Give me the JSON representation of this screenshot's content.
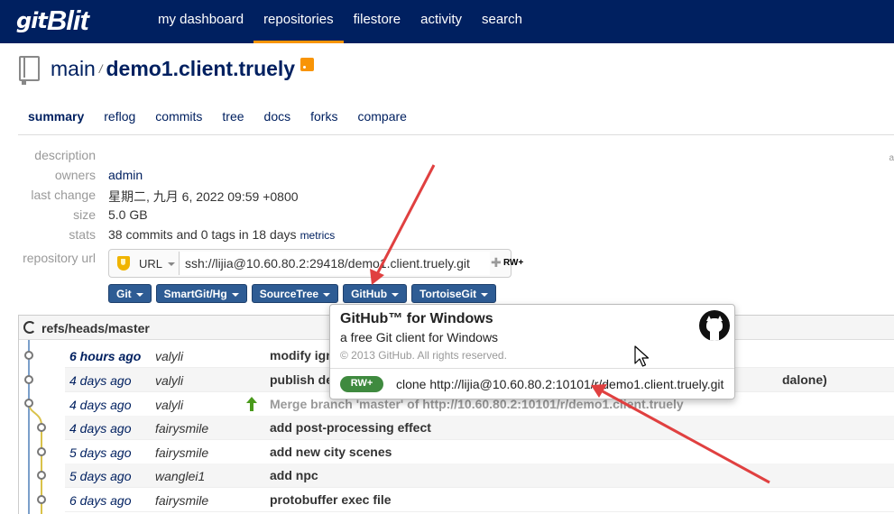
{
  "navbar": {
    "logo_mark": "git",
    "logo_text": "Blit",
    "links": [
      {
        "label": "my dashboard",
        "active": false
      },
      {
        "label": "repositories",
        "active": true
      },
      {
        "label": "filestore",
        "active": false
      },
      {
        "label": "activity",
        "active": false
      },
      {
        "label": "search",
        "active": false
      }
    ],
    "accent_color": "#f89406",
    "bg_color": "#002060"
  },
  "repo": {
    "owner": "main",
    "separator": "/",
    "name": "demo1.client.truely"
  },
  "subnav": {
    "items": [
      "summary",
      "reflog",
      "commits",
      "tree",
      "docs",
      "forks",
      "compare"
    ],
    "active": "summary"
  },
  "summary": {
    "description_label": "description",
    "description_value": "",
    "owners_label": "owners",
    "owners_value": "admin",
    "last_change_label": "last change",
    "last_change_value": "星期二, 九月 6, 2022 09:59 +0800",
    "size_label": "size",
    "size_value": "5.0 GB",
    "stats_label": "stats",
    "stats_value": "38 commits and 0 tags in 18 days",
    "stats_link": "metrics",
    "repo_url_label": "repository url",
    "url_protocol": "URL",
    "url_value": "ssh://lijia@10.60.80.2:29418/demo1.client.truely.git",
    "url_permission": "RW+"
  },
  "clone_buttons": [
    "Git",
    "SmartGit/Hg",
    "SourceTree",
    "GitHub",
    "TortoiseGit"
  ],
  "branch": {
    "title": "refs/heads/master",
    "commits": [
      {
        "date": "6 hours ago",
        "date_bold": true,
        "author": "valyli",
        "message": "modify ign",
        "merge": false
      },
      {
        "date": "4 days ago",
        "date_bold": false,
        "author": "valyli",
        "message": "publish de",
        "message_tail": "dalone)",
        "merge": false
      },
      {
        "date": "4 days ago",
        "date_bold": false,
        "author": "valyli",
        "message": "Merge branch 'master' of http://10.60.80.2:10101/r/demo1.client.truely",
        "merge": true
      },
      {
        "date": "4 days ago",
        "date_bold": false,
        "author": "fairysmile",
        "message": "add post-processing effect",
        "merge": false
      },
      {
        "date": "5 days ago",
        "date_bold": false,
        "author": "fairysmile",
        "message": "add new city scenes",
        "merge": false
      },
      {
        "date": "5 days ago",
        "date_bold": false,
        "author": "wanglei1",
        "message": "add npc",
        "merge": false
      },
      {
        "date": "6 days ago",
        "date_bold": false,
        "author": "fairysmile",
        "message": "protobuffer exec file",
        "merge": false
      }
    ]
  },
  "popup": {
    "title": "GitHub™ for Windows",
    "subtitle": "a free Git client for Windows",
    "copyright": "© 2013 GitHub. All rights reserved.",
    "badge": "RW+",
    "clone_text": "clone http://lijia@10.60.80.2:10101/r/demo1.client.truely.git"
  },
  "icons": {
    "logo": "gitblit-logo",
    "repo": "repository-book-icon",
    "rss": "rss-feed-icon",
    "shield": "shield-icon",
    "puzzle": "puzzle-icon",
    "refresh": "refresh-icon",
    "merge": "merge-arrow-icon",
    "github": "github-octocat-icon",
    "cursor": "mouse-pointer-icon"
  },
  "annotation_color": "#e04040"
}
